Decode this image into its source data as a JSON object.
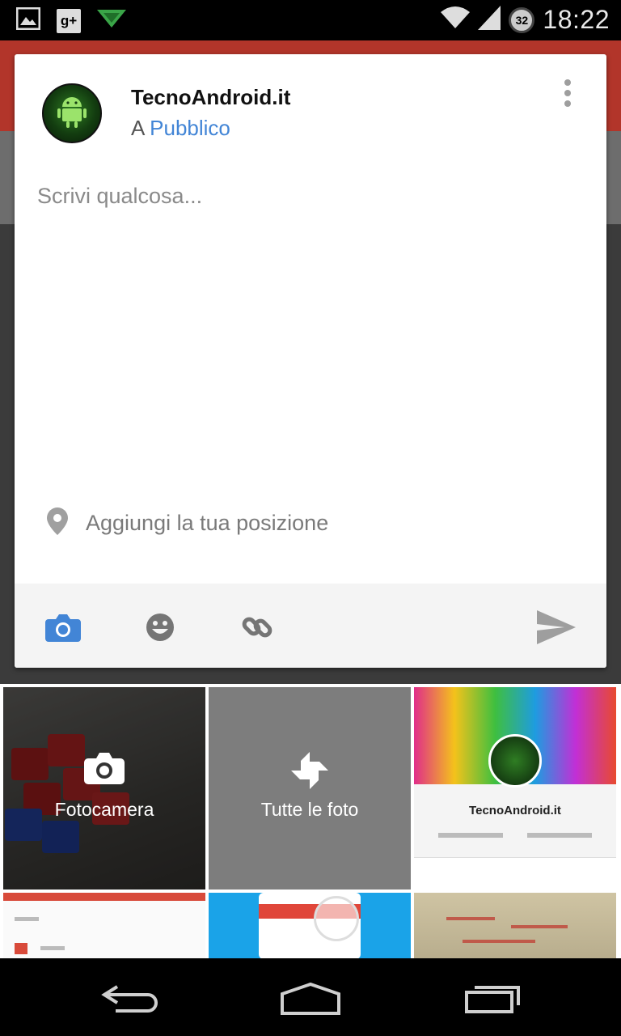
{
  "status_bar": {
    "time": "18:22",
    "gplus_label": "g+",
    "sync_count": "32",
    "icons": [
      "image-icon",
      "google-plus-icon",
      "pushbullet-icon",
      "wifi-icon",
      "signal-icon",
      "sync-icon"
    ]
  },
  "post": {
    "author": "TecnoAndroid.it",
    "audience_prefix": "A",
    "audience": "Pubblico",
    "compose_placeholder": "Scrivi qualcosa...",
    "location_label": "Aggiungi la tua posizione",
    "avatar_icon": "android-logo-icon",
    "menu_icon": "more-vert-icon"
  },
  "toolbar": {
    "items": [
      "camera-icon",
      "emoji-icon",
      "link-icon",
      "send-icon"
    ]
  },
  "gallery": {
    "camera_label": "Fotocamera",
    "all_photos_label": "Tutte le foto",
    "thumb_title": "TecnoAndroid.it"
  },
  "navbar": {
    "items": [
      "back-icon",
      "home-icon",
      "recents-icon"
    ]
  },
  "colors": {
    "accent_blue": "#4285d6",
    "app_red": "#b2352a",
    "send_grey": "#9e9e9e"
  }
}
